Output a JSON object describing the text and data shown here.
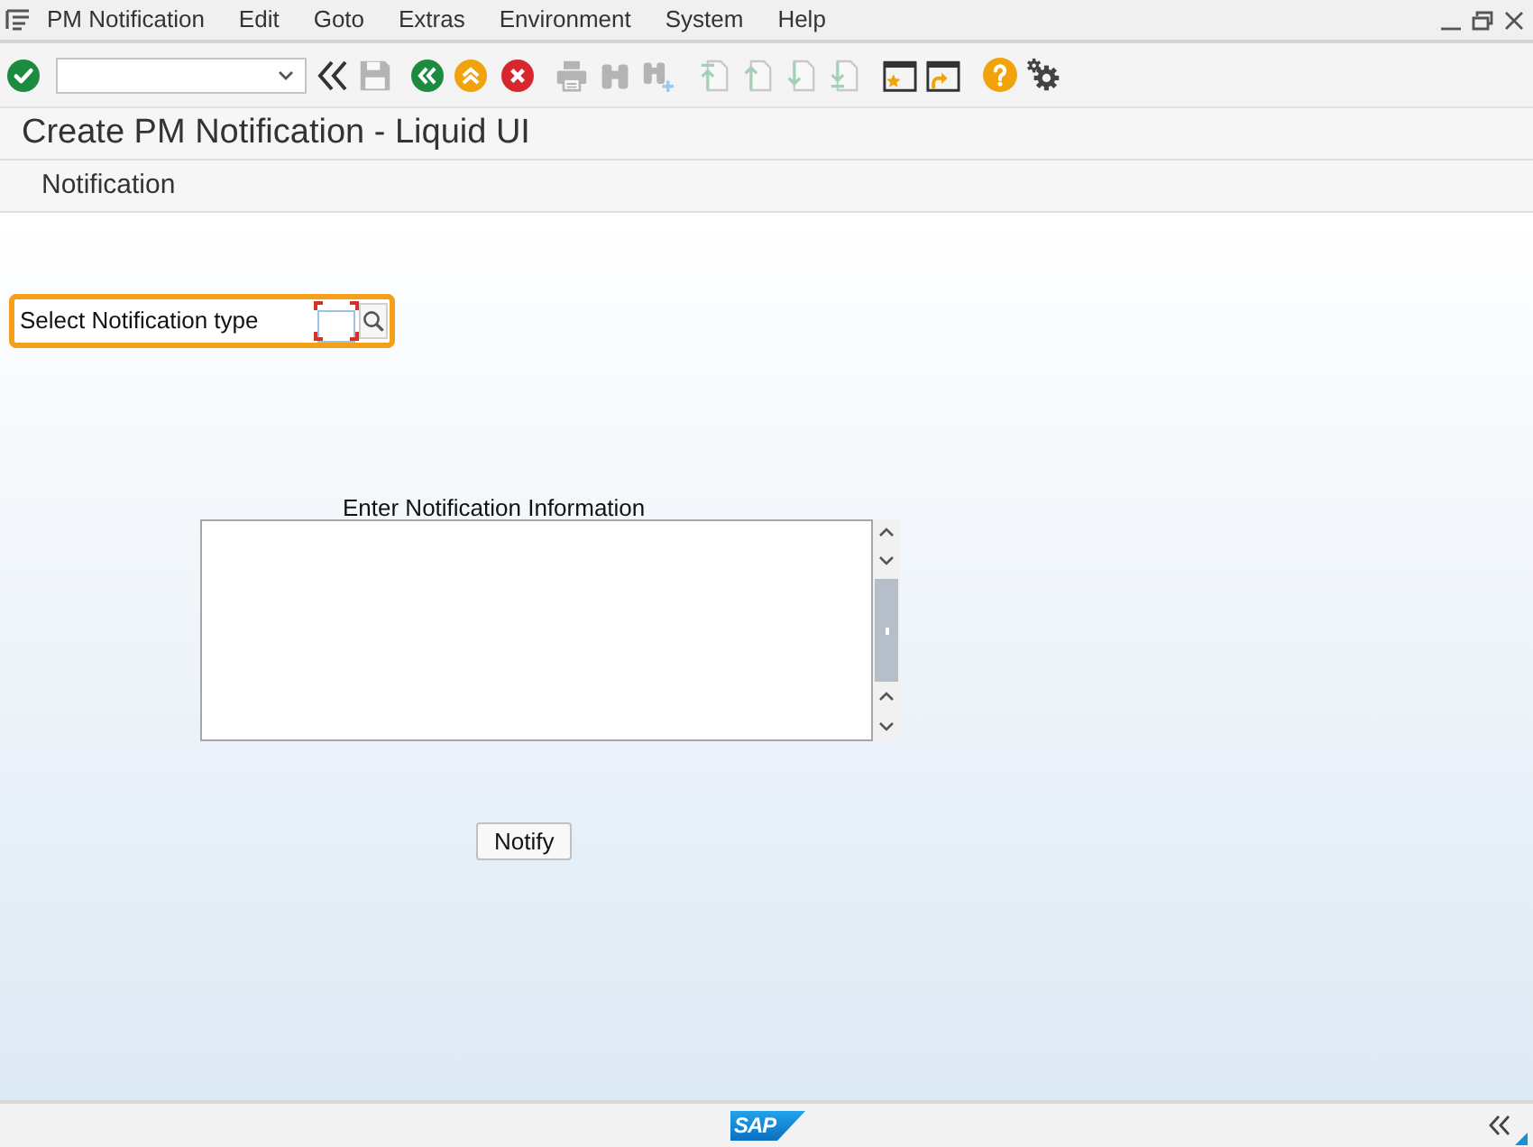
{
  "menu_bar": {
    "items": [
      "PM Notification",
      "Edit",
      "Goto",
      "Extras",
      "Environment",
      "System",
      "Help"
    ]
  },
  "toolbar": {
    "items": [
      {
        "kind": "enter",
        "disabled": false
      },
      {
        "kind": "command_field",
        "disabled": false
      },
      {
        "kind": "collapse",
        "disabled": false
      },
      {
        "kind": "save",
        "disabled": true
      },
      {
        "kind": "back",
        "disabled": false
      },
      {
        "kind": "exit",
        "disabled": false
      },
      {
        "kind": "cancel",
        "disabled": false
      },
      {
        "kind": "print",
        "disabled": true
      },
      {
        "kind": "find",
        "disabled": true
      },
      {
        "kind": "find_next",
        "disabled": true
      },
      {
        "kind": "first_page",
        "disabled": true
      },
      {
        "kind": "previous_page",
        "disabled": true
      },
      {
        "kind": "next_page",
        "disabled": true
      },
      {
        "kind": "last_page",
        "disabled": true
      },
      {
        "kind": "new_session",
        "disabled": false
      },
      {
        "kind": "shortcut",
        "disabled": false
      },
      {
        "kind": "help",
        "disabled": false
      },
      {
        "kind": "settings",
        "disabled": false
      }
    ]
  },
  "title": "Create PM Notification - Liquid UI",
  "application_toolbar": {
    "buttons": [
      "Notification"
    ]
  },
  "form": {
    "notification_type": {
      "label": "Select Notification type",
      "required": true,
      "highlighted": true
    },
    "notification_info": {
      "label": "Enter Notification Information"
    },
    "buttons": [
      "Notify"
    ]
  },
  "status_bar": {
    "logo": "SAP"
  }
}
